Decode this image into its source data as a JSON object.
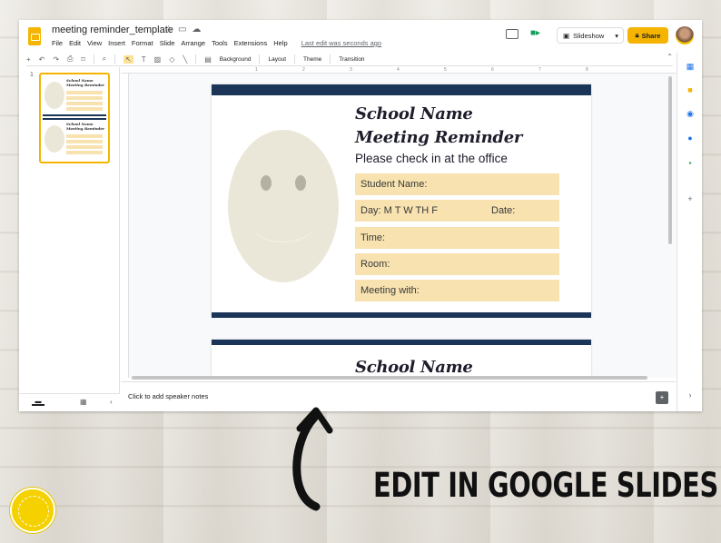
{
  "app": {
    "title": "meeting reminder_template",
    "menu": [
      "File",
      "Edit",
      "View",
      "Insert",
      "Format",
      "Slide",
      "Arrange",
      "Tools",
      "Extensions",
      "Help"
    ],
    "last_edit": "Last edit was seconds ago",
    "slideshow_label": "Slideshow",
    "share_label": "Share"
  },
  "toolbar": {
    "zoom_symbol": "+",
    "background_label": "Background",
    "layout_label": "Layout",
    "theme_label": "Theme",
    "transition_label": "Transition"
  },
  "ruler": [
    "1",
    "2",
    "3",
    "4",
    "5",
    "6",
    "7",
    "8"
  ],
  "thumbnails": {
    "number": "1"
  },
  "slide": {
    "title_line1": "School Name",
    "title_line2": "Meeting Reminder",
    "subtitle": "Please check in at the office",
    "fields": {
      "student": "Student Name:",
      "day": "Day:  M  T  W  TH  F",
      "date": "Date:",
      "time": "Time:",
      "room": "Room:",
      "meeting": "Meeting with:"
    },
    "colors": {
      "stripe": "#1a3557",
      "field": "#f7e2b0",
      "face": "#ebe7d8"
    }
  },
  "slide2": {
    "title_line1": "School Name"
  },
  "notes": {
    "placeholder": "Click to add speaker notes"
  },
  "annotation": {
    "caption": "EDIT IN GOOGLE SLIDES"
  },
  "colors": {
    "brand": "#f4b400",
    "share": "#f4b400"
  }
}
